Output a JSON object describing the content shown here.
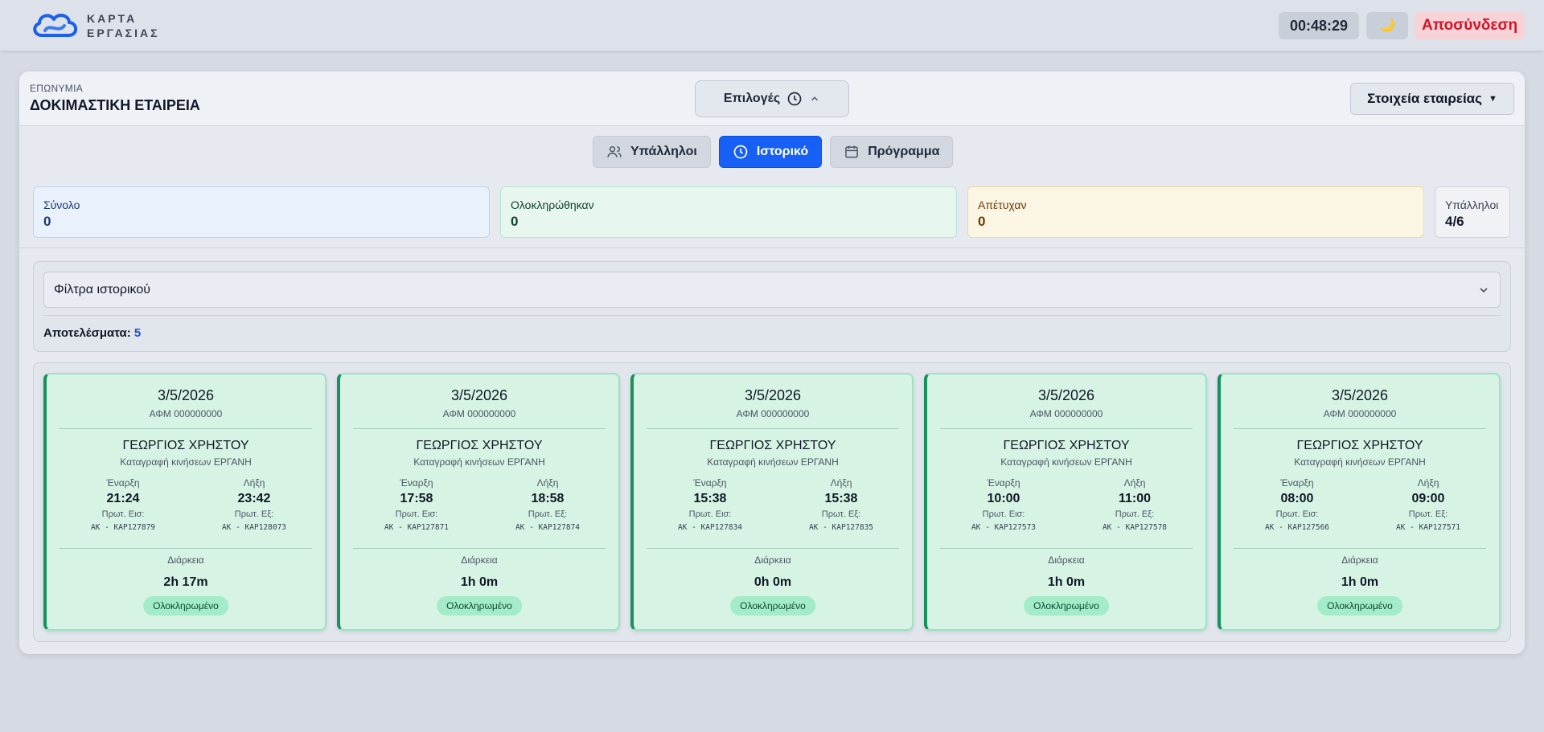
{
  "header": {
    "logo_line1": "ΚΑΡΤΑ",
    "logo_line2": "ΕΡΓΑΣΙΑΣ",
    "timer": "00:48:29",
    "theme_icon": "moon-icon",
    "logout_label": "Αποσύνδεση",
    "colors": {
      "logout": "#d11528",
      "logo_blue": "#1d5fe8"
    }
  },
  "company": {
    "label": "ΕΠΩΝΥΜΙΑ",
    "name": "ΔΟΚΙΜΑΣΤΙΚΗ ΕΤΑΙΡΕΙΑ",
    "options_label": "Επιλογές",
    "info_label": "Στοιχεία εταιρείας"
  },
  "tabs": [
    {
      "label": "Υπάλληλοι",
      "icon": "users-icon",
      "active": false
    },
    {
      "label": "Ιστορικό",
      "icon": "clock-icon",
      "active": true
    },
    {
      "label": "Πρόγραμμα",
      "icon": "calendar-icon",
      "active": false
    }
  ],
  "stats": {
    "total": {
      "label": "Σύνολο",
      "value": "0"
    },
    "completed": {
      "label": "Ολοκληρώθηκαν",
      "value": "0"
    },
    "failed": {
      "label": "Απέτυχαν",
      "value": "0"
    },
    "employees": {
      "label": "Υπάλληλοι",
      "value": "4/6"
    }
  },
  "filters": {
    "title": "Φίλτρα ιστορικού",
    "results_label": "Αποτελέσματα:",
    "results_count": "5"
  },
  "card_labels": {
    "start": "Έναρξη",
    "end": "Λήξη",
    "first_in": "Πρωτ. Εισ:",
    "first_out": "Πρωτ. Εξ:",
    "duration": "Διάρκεια"
  },
  "cards": [
    {
      "date": "3/5/2026",
      "afm": "ΑΦΜ 000000000",
      "name": "ΓΕΩΡΓΙΟΣ ΧΡΗΣΤΟΥ",
      "desc": "Καταγραφή κινήσεων ΕΡΓΑΝΗ",
      "start": "21:24",
      "end": "23:42",
      "in_code": "AK - KAP127879",
      "out_code": "AK - KAP128073",
      "duration": "2h 17m",
      "status": "Ολοκληρωμένο"
    },
    {
      "date": "3/5/2026",
      "afm": "ΑΦΜ 000000000",
      "name": "ΓΕΩΡΓΙΟΣ ΧΡΗΣΤΟΥ",
      "desc": "Καταγραφή κινήσεων ΕΡΓΑΝΗ",
      "start": "17:58",
      "end": "18:58",
      "in_code": "AK - KAP127871",
      "out_code": "AK - KAP127874",
      "duration": "1h 0m",
      "status": "Ολοκληρωμένο"
    },
    {
      "date": "3/5/2026",
      "afm": "ΑΦΜ 000000000",
      "name": "ΓΕΩΡΓΙΟΣ ΧΡΗΣΤΟΥ",
      "desc": "Καταγραφή κινήσεων ΕΡΓΑΝΗ",
      "start": "15:38",
      "end": "15:38",
      "in_code": "AK - KAP127834",
      "out_code": "AK - KAP127835",
      "duration": "0h 0m",
      "status": "Ολοκληρωμένο"
    },
    {
      "date": "3/5/2026",
      "afm": "ΑΦΜ 000000000",
      "name": "ΓΕΩΡΓΙΟΣ ΧΡΗΣΤΟΥ",
      "desc": "Καταγραφή κινήσεων ΕΡΓΑΝΗ",
      "start": "10:00",
      "end": "11:00",
      "in_code": "AK - KAP127573",
      "out_code": "AK - KAP127578",
      "duration": "1h 0m",
      "status": "Ολοκληρωμένο"
    },
    {
      "date": "3/5/2026",
      "afm": "ΑΦΜ 000000000",
      "name": "ΓΕΩΡΓΙΟΣ ΧΡΗΣΤΟΥ",
      "desc": "Καταγραφή κινήσεων ΕΡΓΑΝΗ",
      "start": "08:00",
      "end": "09:00",
      "in_code": "AK - KAP127566",
      "out_code": "AK - KAP127571",
      "duration": "1h 0m",
      "status": "Ολοκληρωμένο"
    }
  ]
}
